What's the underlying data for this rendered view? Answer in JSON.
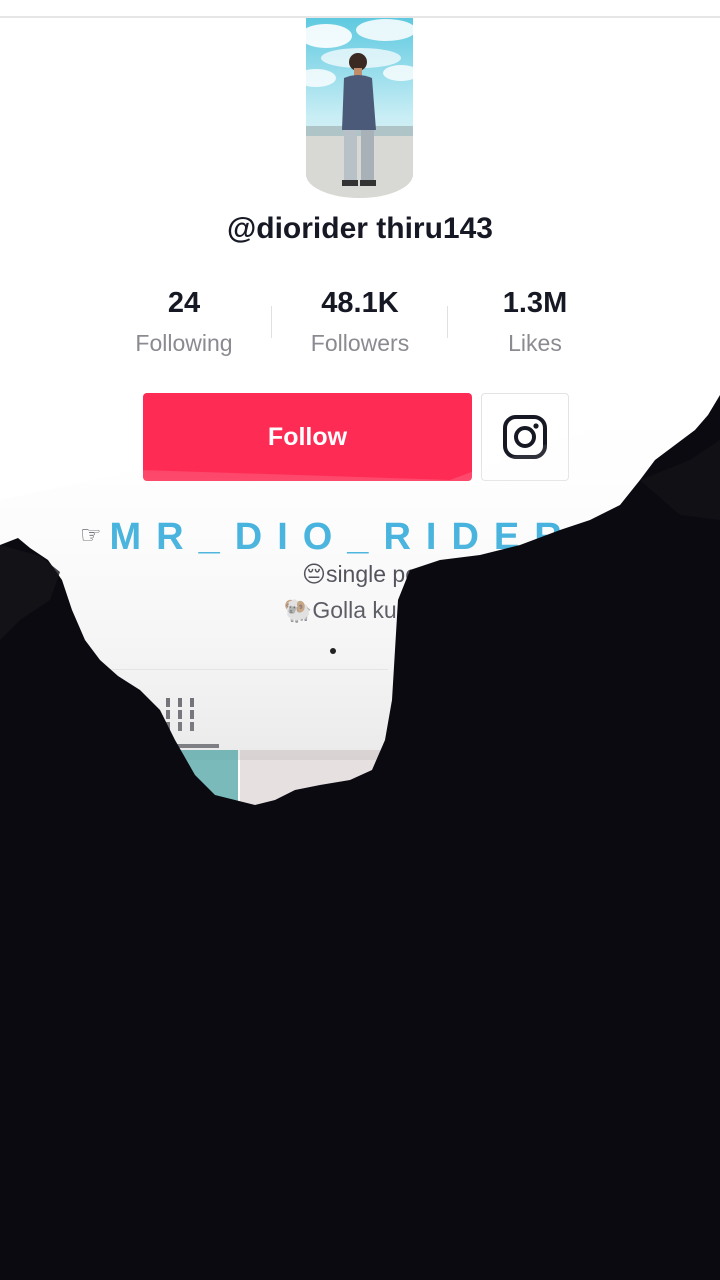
{
  "profile": {
    "username": "@diorider thiru143",
    "avatar_icon": "profile-photo"
  },
  "stats": [
    {
      "value": "24",
      "label": "Following"
    },
    {
      "value": "48.1K",
      "label": "Followers"
    },
    {
      "value": "1.3M",
      "label": "Likes"
    }
  ],
  "actions": {
    "follow_label": "Follow",
    "follow_color": "#fe2c55",
    "instagram_icon": "instagram-icon"
  },
  "bio": {
    "pointer_glyph": "☞",
    "line1": "MR_DIO_RIDER",
    "line1_color": "#1aa3d9",
    "line2": "😔single pe",
    "line3": "🐏Golla kurma"
  },
  "tabs": {
    "videos_icon": "videos-grid-icon"
  }
}
